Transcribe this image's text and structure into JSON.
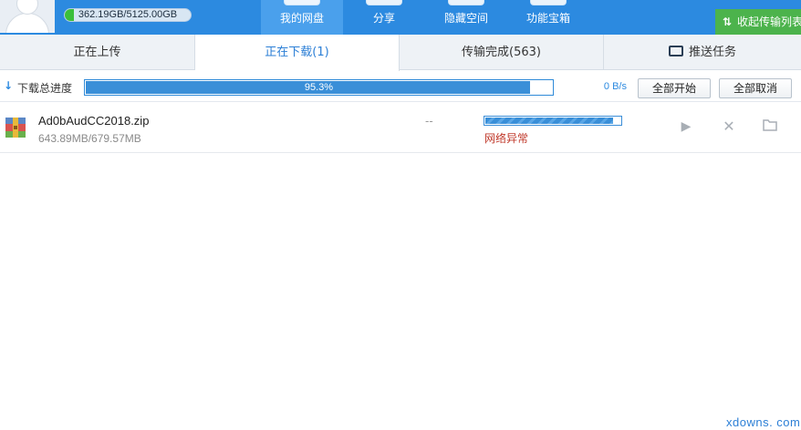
{
  "header": {
    "quota_text": "362.19GB/5125.00GB",
    "quota_used_fraction": 0.071,
    "nav": [
      {
        "label": "我的网盘",
        "active": true
      },
      {
        "label": "分享",
        "active": false
      },
      {
        "label": "隐藏空间",
        "active": false
      },
      {
        "label": "功能宝箱",
        "active": false
      }
    ],
    "collapse_label": "收起传输列表",
    "accent_color": "#2c8ae0",
    "collapse_color": "#4cb34c"
  },
  "tabs": [
    {
      "label": "正在上传"
    },
    {
      "label": "正在下载(1)"
    },
    {
      "label": "传输完成(563)"
    },
    {
      "label": "推送任务"
    }
  ],
  "progress": {
    "label": "下载总进度",
    "percent_text": "95.3%",
    "percent_value": 95.3,
    "speed": "0 B/s",
    "start_all": "全部开始",
    "cancel_all": "全部取消"
  },
  "downloads": [
    {
      "name": "Ad0bAudCC2018.zip",
      "size": "643.89MB/679.57MB",
      "eta": "--",
      "progress_fraction": 0.947,
      "status": "网络异常",
      "icons": [
        "play-icon",
        "close-icon",
        "folder-icon"
      ]
    }
  ],
  "watermark": "xdowns. com"
}
